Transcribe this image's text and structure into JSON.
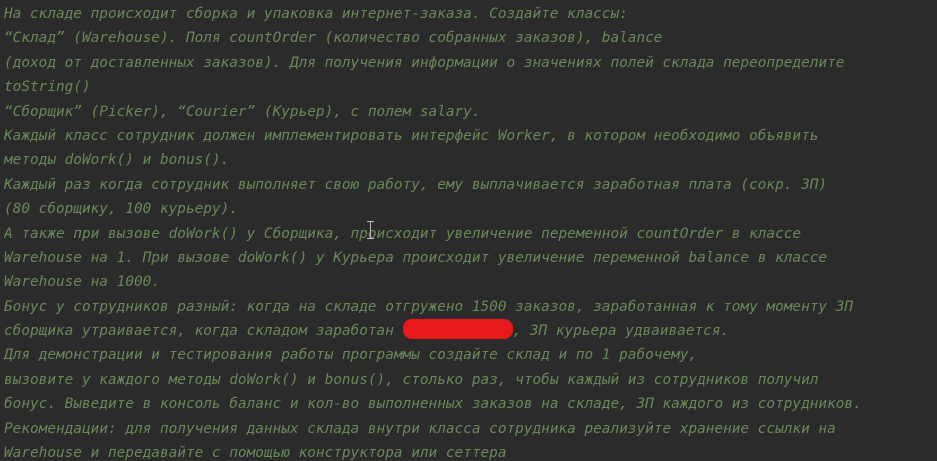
{
  "editor": {
    "text_color": "#6a8759",
    "background": "#2b2b2b",
    "lines": [
      "На складе происходит сборка и упаковка интернет-заказа. Создайте классы:",
      "“Склад” (Warehouse). Поля countOrder (количество собранных заказов), balance",
      "(доход от доставленных заказов). Для получения информации о значениях полей склада переопределите",
      "toString()",
      "“Сборщик” (Picker), “Courier” (Курьер), с полем salary.",
      "Каждый класс сотрудник должен имплементировать интерфейс Worker, в котором необходимо объявить",
      "методы doWork() и bonus().",
      "Каждый раз когда сотрудник выполняет свою работу, ему выплачивается заработная плата (сокр. ЗП)",
      "(80 сборщику, 100 курьеру).",
      "А также при вызове doWork() у Сборщика, происходит увеличение переменной countOrder в классе",
      "Warehouse на 1. При вызове doWork() у Курьера происходит увеличение переменной balance в классе",
      "Warehouse на 1000.",
      "Бонус у сотрудников разный: когда на складе отгружено 1500 заказов, заработанная к тому моменту ЗП",
      "сборщика утраивается, когда складом заработан",
      "Для демонстрации и тестирования работы программы создайте склад и по 1 рабочему,",
      "вызовите у каждого методы doWork() и bonus(), столько раз, чтобы каждый из сотрудников получил",
      "бонус. Выведите в консоль баланс и кол-во выполненных заказов на складе, ЗП каждого из сотрудников.",
      "Рекомендации: для получения данных склада внутри класса сотрудника реализуйте хранение ссылки на",
      "Warehouse и передавайте с помощью конструктора или сеттера"
    ],
    "line_14_suffix": ", ЗП курьера удваивается.",
    "redaction_color": "#e8191d"
  }
}
